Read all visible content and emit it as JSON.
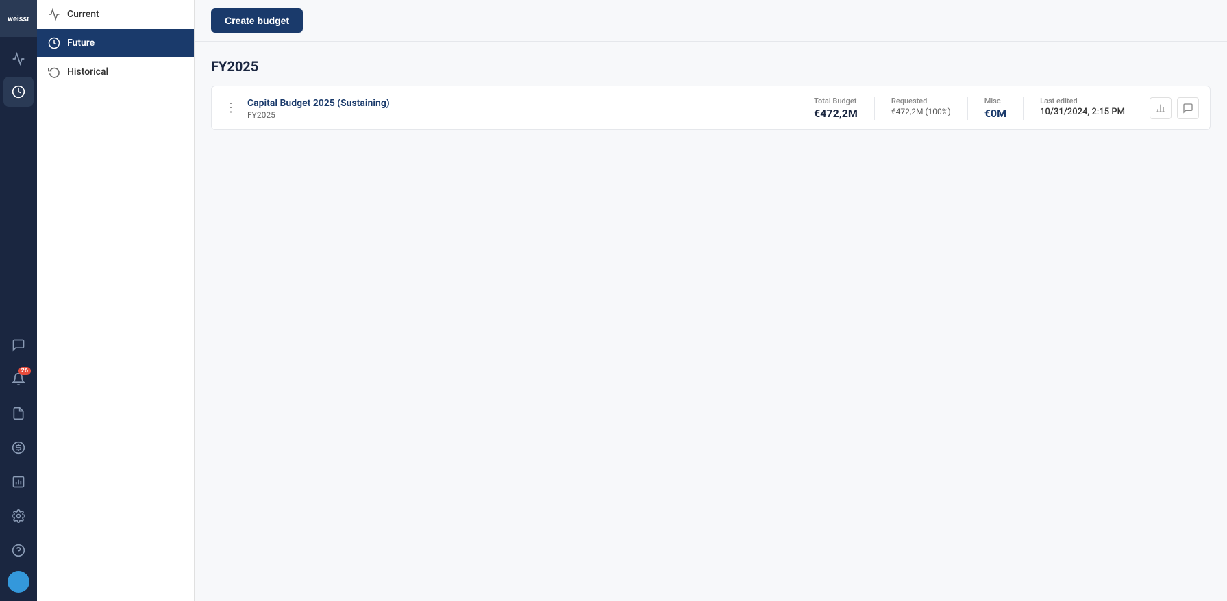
{
  "nav": {
    "logo_text": "weissr",
    "items": [
      {
        "id": "analytics",
        "label": "Analytics",
        "active": false
      },
      {
        "id": "budget",
        "label": "Budget",
        "active": true
      }
    ],
    "bottom_items": [
      {
        "id": "chat",
        "label": "Chat",
        "badge": null
      },
      {
        "id": "notifications",
        "label": "Notifications",
        "badge": "26"
      },
      {
        "id": "documents",
        "label": "Documents",
        "badge": null
      },
      {
        "id": "currency",
        "label": "Currency",
        "badge": null
      },
      {
        "id": "report",
        "label": "Report",
        "badge": null
      },
      {
        "id": "settings",
        "label": "Settings",
        "badge": null
      },
      {
        "id": "help",
        "label": "Help",
        "badge": null
      }
    ],
    "avatar_initials": ""
  },
  "sidebar": {
    "items": [
      {
        "id": "current",
        "label": "Current",
        "active": false
      },
      {
        "id": "future",
        "label": "Future",
        "active": true
      },
      {
        "id": "historical",
        "label": "Historical",
        "active": false
      }
    ]
  },
  "toolbar": {
    "create_budget_label": "Create budget"
  },
  "main": {
    "fiscal_year_label": "FY2025",
    "budgets": [
      {
        "id": "budget-1",
        "title": "Capital Budget 2025 (Sustaining)",
        "fiscal_year": "FY2025",
        "total_budget_label": "Total Budget",
        "total_budget_value": "€472,2M",
        "requested_label": "Requested",
        "requested_value": "€472,2M (100%)",
        "misc_label": "Misc",
        "misc_value": "€0M",
        "last_edited_label": "Last edited",
        "last_edited_value": "10/31/2024, 2:15 PM"
      }
    ]
  }
}
